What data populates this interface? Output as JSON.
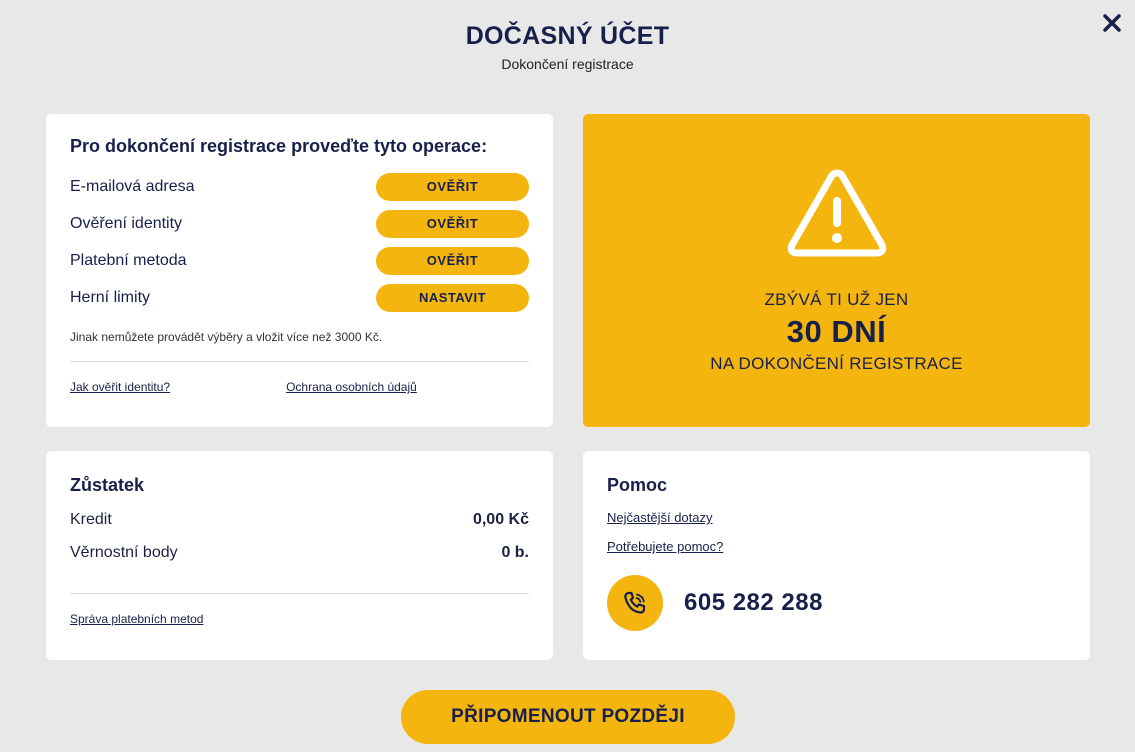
{
  "header": {
    "title": "DOČASNÝ ÚČET",
    "subtitle": "Dokončení registrace"
  },
  "operations": {
    "title": "Pro dokončení registrace proveďte tyto operace:",
    "items": [
      {
        "label": "E-mailová adresa",
        "button": "OVĚŘIT"
      },
      {
        "label": "Ověření identity",
        "button": "OVĚŘIT"
      },
      {
        "label": "Platební metoda",
        "button": "OVĚŘIT"
      },
      {
        "label": "Herní limity",
        "button": "NASTAVIT"
      }
    ],
    "note": "Jinak nemůžete provádět výběry a vložit více než 3000 Kč.",
    "links": [
      "Jak ověřit identitu?",
      "Ochrana osobních údajů"
    ]
  },
  "warning": {
    "line1": "ZBÝVÁ TI UŽ JEN",
    "days": "30 DNÍ",
    "line3": "NA DOKONČENÍ REGISTRACE",
    "icon": "warning-triangle-icon"
  },
  "balance": {
    "title": "Zůstatek",
    "rows": [
      {
        "label": "Kredit",
        "value": "0,00 Kč"
      },
      {
        "label": "Věrnostní body",
        "value": "0 b."
      }
    ],
    "link": "Správa platebních metod"
  },
  "help": {
    "title": "Pomoc",
    "links": [
      "Nejčastější dotazy",
      "Potřebujete pomoc?"
    ],
    "phone": "605 282 288",
    "phone_icon": "phone-icon"
  },
  "remind_button": "PŘIPOMENOUT POZDĚJI",
  "colors": {
    "accent": "#f5b50f",
    "text": "#17204a",
    "background": "#e8e8e8"
  }
}
